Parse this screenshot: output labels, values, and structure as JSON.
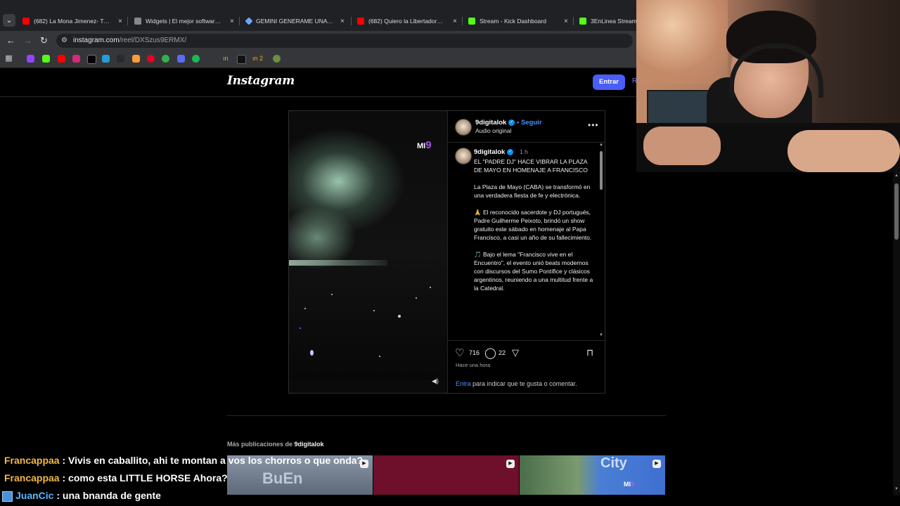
{
  "browser": {
    "tabs": [
      {
        "title": "(682) La Mona Jimenez- Tu me",
        "color": "#ff0000"
      },
      {
        "title": "Widgets | El mejor software pa",
        "color": "#888888"
      },
      {
        "title": "GEMINI GENERAME UNA IMAG",
        "color": "#6fa3ff"
      },
      {
        "title": "(682) Quiero la Libertadores y",
        "color": "#ff0000"
      },
      {
        "title": "Stream - Kick Dashboard",
        "color": "#53fc18"
      },
      {
        "title": "3EnLinea Stream -",
        "color": "#53fc18"
      }
    ],
    "close_glyph": "×",
    "url_host": "instagram.com",
    "url_path": "/reel/DXSzus9ERMX/",
    "bookmark_labels": [
      "ın",
      "ın 2"
    ]
  },
  "instagram": {
    "logo_text": "Instagram",
    "login_button": "Entrar",
    "header_cut": "R",
    "post": {
      "username": "9digitalok",
      "follow_sep": "•",
      "follow_label": "Seguir",
      "audio": "Audio original",
      "caption_time": "1 h",
      "caption": [
        "EL \"PADRE DJ\" HACE VIBRAR LA PLAZA DE MAYO EN HOMENAJE A FRANCISCO",
        "La Plaza de Mayo (CABA) se transformó en una verdadera fiesta de fe y electrónica.",
        "🙏 El reconocido sacerdote y DJ portugués, Padre Guilherme Peixoto, brindó un show gratuito este sábado en homenaje al Papa Francisco, a casi un año de su fallecimiento.",
        "🎵 Bajo el lema \"Francisco vive en el Encuentro\", el evento unió beats modernos con discursos del Sumo Pontífice y clásicos argentinos, reuniendo a una multitud frente a la Catedral."
      ],
      "likes": "716",
      "comments": "22",
      "time_ago": "Hace una hora",
      "login_link": "Entra",
      "login_prompt": " para indicar que te gusta o comentar.",
      "video_watermark": "MI",
      "video_watermark_nine": "9"
    },
    "more_posts": {
      "label": "Más publicaciones de ",
      "username": "9digitalok",
      "thumb1_text": "BuEn",
      "thumb3_text": "City",
      "thumb3_logo": "MI",
      "thumb3_logo_nine": "9"
    }
  },
  "chat": [
    {
      "user": "Francappaa",
      "message": " : Vivis en caballito, ahi te montan a vos los chorros o que onda?",
      "badge": false
    },
    {
      "user": "Francappaa",
      "message": " : como esta LITTLE HORSE Ahora?",
      "badge": false
    },
    {
      "user": "JuanCic",
      "message": " : una bnanda de gente",
      "badge": true
    }
  ],
  "colors": {
    "accent_blue": "#4a5df9",
    "link_blue": "#4f8dff",
    "chat_user_gold": "#f2b845",
    "chat_user_blue": "#5ab7ff"
  }
}
